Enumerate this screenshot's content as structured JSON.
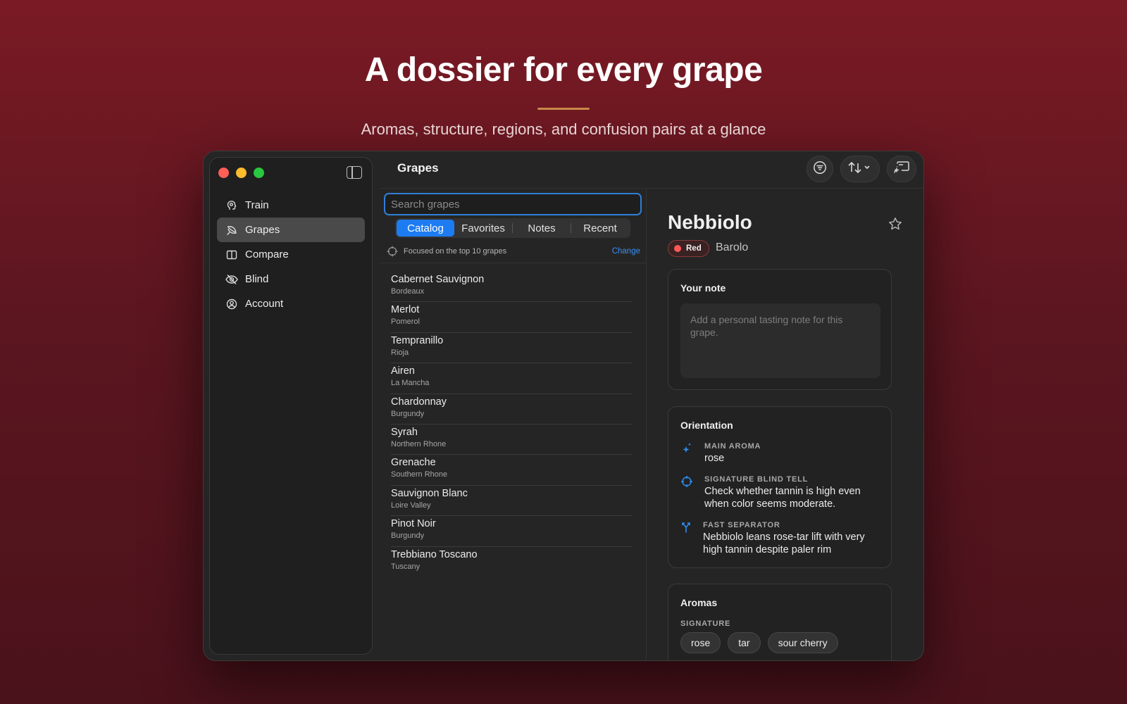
{
  "hero": {
    "title": "A dossier for every grape",
    "subtitle": "Aromas, structure, regions, and confusion pairs at a glance",
    "accent_color": "#c98a4a"
  },
  "window": {
    "title": "Grapes",
    "toolbar": {
      "filter_icon": "filter-icon",
      "sort_icon": "sort-arrows-icon",
      "cast_icon": "cast-icon"
    }
  },
  "sidebar": {
    "items": [
      {
        "label": "Train",
        "icon": "brain-icon",
        "active": false
      },
      {
        "label": "Grapes",
        "icon": "leaf-icon",
        "active": true
      },
      {
        "label": "Compare",
        "icon": "columns-icon",
        "active": false
      },
      {
        "label": "Blind",
        "icon": "eye-slash-icon",
        "active": false
      },
      {
        "label": "Account",
        "icon": "person-circle-icon",
        "active": false
      }
    ]
  },
  "list_pane": {
    "search_placeholder": "Search grapes",
    "tabs": [
      {
        "label": "Catalog",
        "active": true
      },
      {
        "label": "Favorites",
        "active": false
      },
      {
        "label": "Notes",
        "active": false
      },
      {
        "label": "Recent",
        "active": false
      }
    ],
    "focus_text": "Focused on the top 10 grapes",
    "focus_action": "Change",
    "grapes": [
      {
        "name": "Cabernet Sauvignon",
        "region": "Bordeaux"
      },
      {
        "name": "Merlot",
        "region": "Pomerol"
      },
      {
        "name": "Tempranillo",
        "region": "Rioja"
      },
      {
        "name": "Airen",
        "region": "La Mancha"
      },
      {
        "name": "Chardonnay",
        "region": "Burgundy"
      },
      {
        "name": "Syrah",
        "region": "Northern Rhone"
      },
      {
        "name": "Grenache",
        "region": "Southern Rhone"
      },
      {
        "name": "Sauvignon Blanc",
        "region": "Loire Valley"
      },
      {
        "name": "Pinot Noir",
        "region": "Burgundy"
      },
      {
        "name": "Trebbiano Toscano",
        "region": "Tuscany"
      }
    ]
  },
  "detail": {
    "name": "Nebbiolo",
    "color_badge": "Red",
    "badge_color": "#ff5858",
    "region": "Barolo",
    "note": {
      "title": "Your note",
      "placeholder": "Add a personal tasting note for this grape."
    },
    "orientation": {
      "title": "Orientation",
      "rows": [
        {
          "label": "MAIN AROMA",
          "value": "rose",
          "icon": "sparkles-icon"
        },
        {
          "label": "SIGNATURE BLIND TELL",
          "value": "Check whether tannin is high even when color seems moderate.",
          "icon": "crosshair-icon"
        },
        {
          "label": "FAST SEPARATOR",
          "value": "Nebbiolo leans rose-tar lift with very high tannin despite paler rim",
          "icon": "fork-icon"
        }
      ]
    },
    "aromas": {
      "title": "Aromas",
      "signature_label": "SIGNATURE",
      "chips": [
        "rose",
        "tar",
        "sour cherry"
      ]
    }
  }
}
